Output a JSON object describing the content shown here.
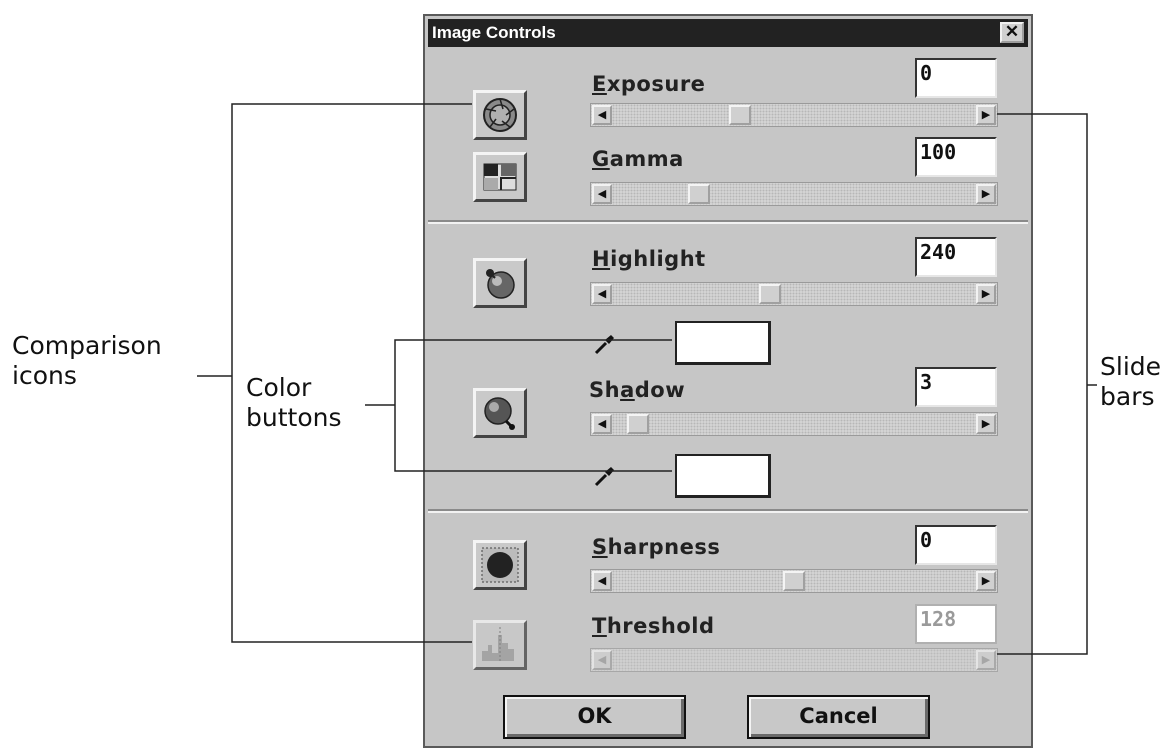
{
  "annotations": {
    "comparison_icons": "Comparison\nicons",
    "color_buttons": "Color\nbuttons",
    "slide_bars": "Slide\nbars"
  },
  "dialog": {
    "title": "Image Controls",
    "close_glyph": "✕",
    "ok_label": "OK",
    "cancel_label": "Cancel"
  },
  "controls": {
    "exposure": {
      "label": "Exposure",
      "mnemonic": "E",
      "value": "0",
      "slider_fraction": 0.34,
      "icon": "aperture-icon"
    },
    "gamma": {
      "label": "Gamma",
      "mnemonic": "G",
      "value": "100",
      "slider_fraction": 0.22,
      "icon": "gamma-icon"
    },
    "highlight": {
      "label": "Highlight",
      "mnemonic": "H",
      "value": "240",
      "slider_fraction": 0.43,
      "icon": "highlight-sphere-icon"
    },
    "shadow": {
      "label": "Shadow",
      "mnemonic": "a",
      "value": "3",
      "slider_fraction": 0.04,
      "icon": "shadow-sphere-icon"
    },
    "sharpness": {
      "label": "Sharpness",
      "mnemonic": "S",
      "value": "0",
      "slider_fraction": 0.5,
      "icon": "sharpness-icon"
    },
    "threshold": {
      "label": "Threshold",
      "mnemonic": "T",
      "value": "128",
      "slider_fraction": 0.0,
      "disabled": true,
      "icon": "threshold-histogram-icon"
    }
  },
  "icons": {
    "arrow_left": "◀",
    "arrow_right": "▶",
    "dropper": "eyedropper-icon"
  },
  "colors": {
    "dialog_bg": "#c6c6c6",
    "titlebar_bg": "#222222",
    "disabled_text": "#9a9a9a"
  }
}
